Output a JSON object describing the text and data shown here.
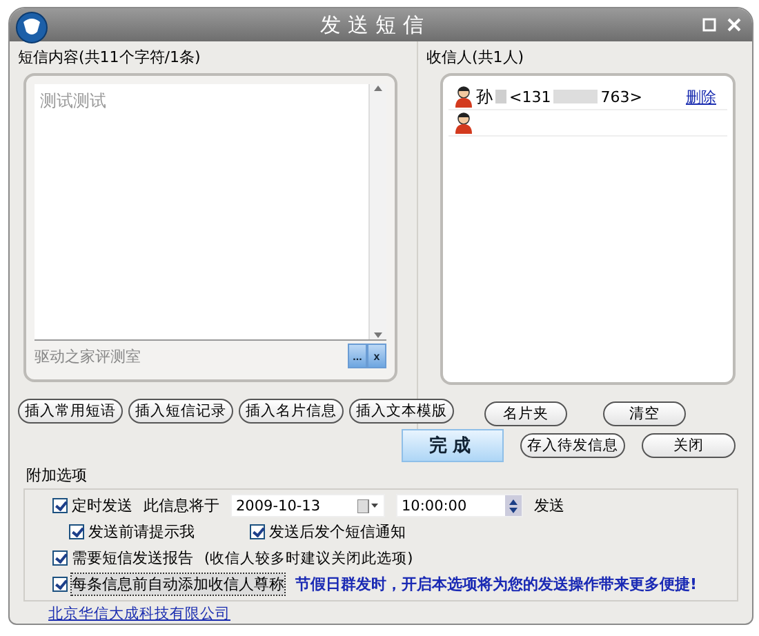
{
  "window": {
    "title": "发送短信"
  },
  "message": {
    "heading": "短信内容(共11个字符/1条)",
    "text": "测试测试",
    "signature": "驱动之家评测室",
    "sig_buttons": [
      "...",
      "x"
    ]
  },
  "insert_buttons": [
    "插入常用短语",
    "插入短信记录",
    "插入名片信息",
    "插入文本模版"
  ],
  "recipients": {
    "heading": "收信人(共1人)",
    "rows": [
      {
        "kind": "contact",
        "name": "孙",
        "phone_start": "<131",
        "phone_end": "763>",
        "action": "删除"
      },
      {
        "kind": "empty"
      }
    ],
    "buttons": [
      "名片夹",
      "清空"
    ]
  },
  "actions": [
    {
      "label": "完成",
      "primary": true
    },
    {
      "label": "存入待发信息",
      "primary": false
    },
    {
      "label": "关闭",
      "primary": false
    }
  ],
  "options": {
    "heading": "附加选项",
    "schedule": {
      "label": "定时发送",
      "checked": true,
      "prefix": "此信息将于",
      "date": "2009-10-13",
      "time": "10:00:00",
      "suffix": "发送"
    },
    "sub": [
      {
        "label": "发送前请提示我",
        "checked": true
      },
      {
        "label": "发送后发个短信通知",
        "checked": true
      }
    ],
    "report": {
      "label": "需要短信发送报告",
      "checked": true,
      "note": "(收信人较多时建议关闭此选项)"
    },
    "salutation": {
      "label": "每条信息前自动添加收信人尊称",
      "checked": true,
      "focused": true,
      "tip": "节假日群发时，开启本选项将为您的发送操作带来更多便捷!"
    }
  },
  "footer_link": "北京华信大成科技有限公司"
}
